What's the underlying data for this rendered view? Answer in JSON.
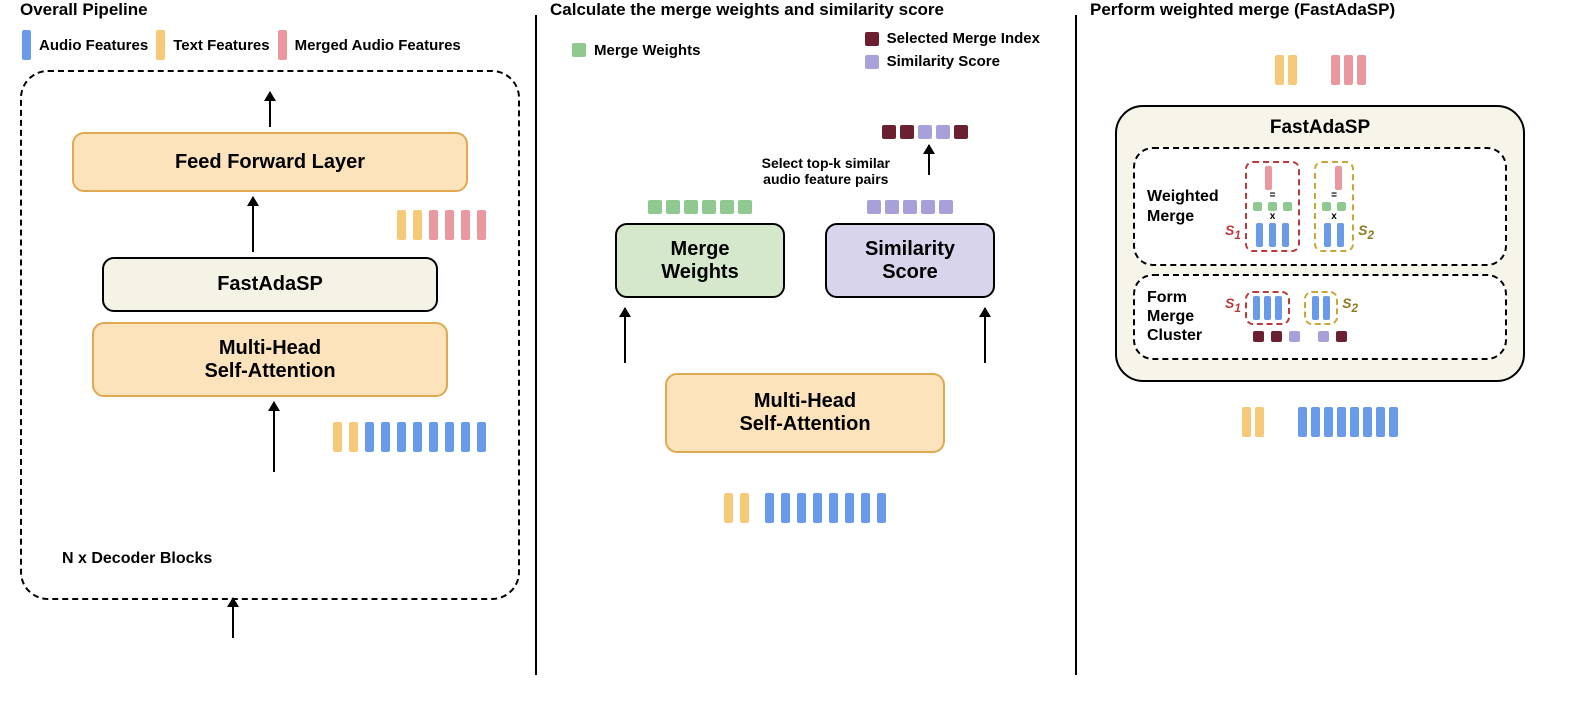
{
  "panel1": {
    "title": "Overall Pipeline",
    "legend": {
      "audio": "Audio Features",
      "text": "Text Features",
      "merged": "Merged Audio Features"
    },
    "blocks": {
      "ffl": "Feed Forward Layer",
      "fastadasp": "FastAdaSP",
      "mhsa": "Multi-Head\nSelf-Attention"
    },
    "nblocks": "N x Decoder Blocks"
  },
  "panel2": {
    "title": "Calculate the merge weights and similarity score",
    "legend": {
      "mw": "Merge Weights",
      "smi": "Selected Merge Index",
      "ss": "Similarity Score"
    },
    "topk": "Select top-k similar\naudio feature pairs",
    "blocks": {
      "mw": "Merge\nWeights",
      "ss": "Similarity\nScore",
      "mhsa": "Multi-Head\nSelf-Attention"
    }
  },
  "panel3": {
    "title": "Perform weighted merge (FastAdaSP)",
    "heading": "FastAdaSP",
    "wm": "Weighted\nMerge",
    "fmc": "Form Merge\nCluster",
    "s1": "S",
    "s1sub": "1",
    "s2": "S",
    "s2sub": "2",
    "eq": "=",
    "x": "x"
  }
}
